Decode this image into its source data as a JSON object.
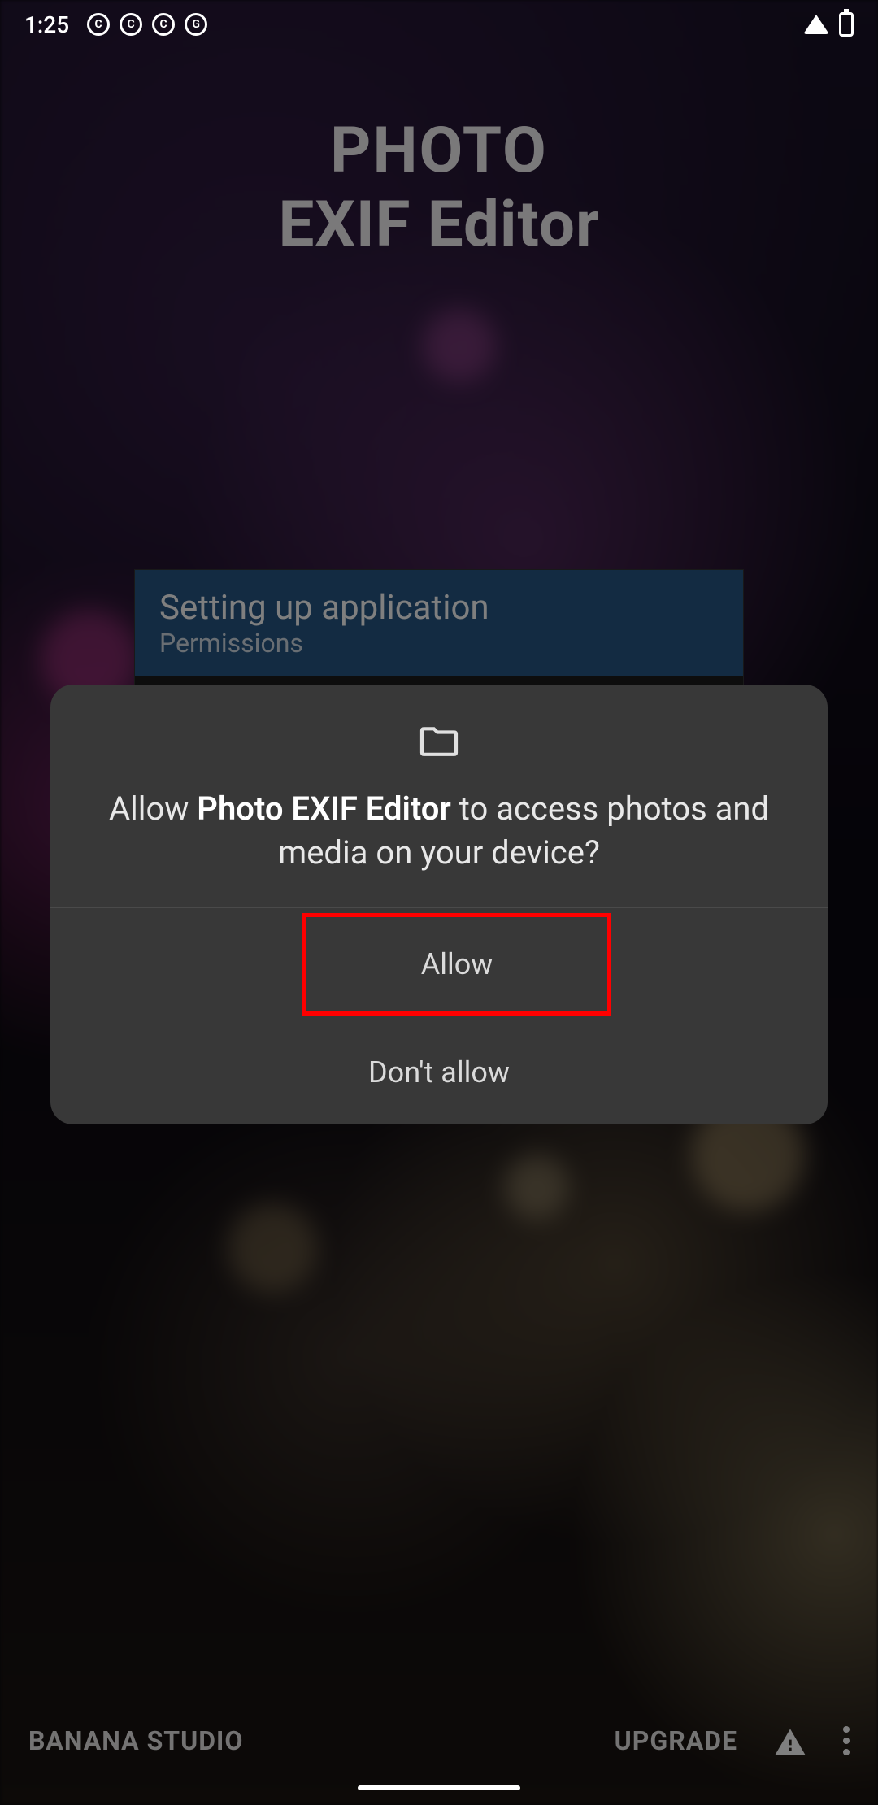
{
  "status_bar": {
    "time": "1:25"
  },
  "app": {
    "title_line1": "PHOTO",
    "title_line2": "EXIF Editor"
  },
  "setup": {
    "title": "Setting up application",
    "subtitle": "Permissions"
  },
  "dialog": {
    "text_prefix": "Allow ",
    "app_name": "Photo EXIF Editor",
    "text_suffix": " to access photos and media on your device?",
    "allow_label": "Allow",
    "deny_label": "Don't allow"
  },
  "bottom": {
    "brand": "BANANA STUDIO",
    "upgrade": "UPGRADE"
  }
}
